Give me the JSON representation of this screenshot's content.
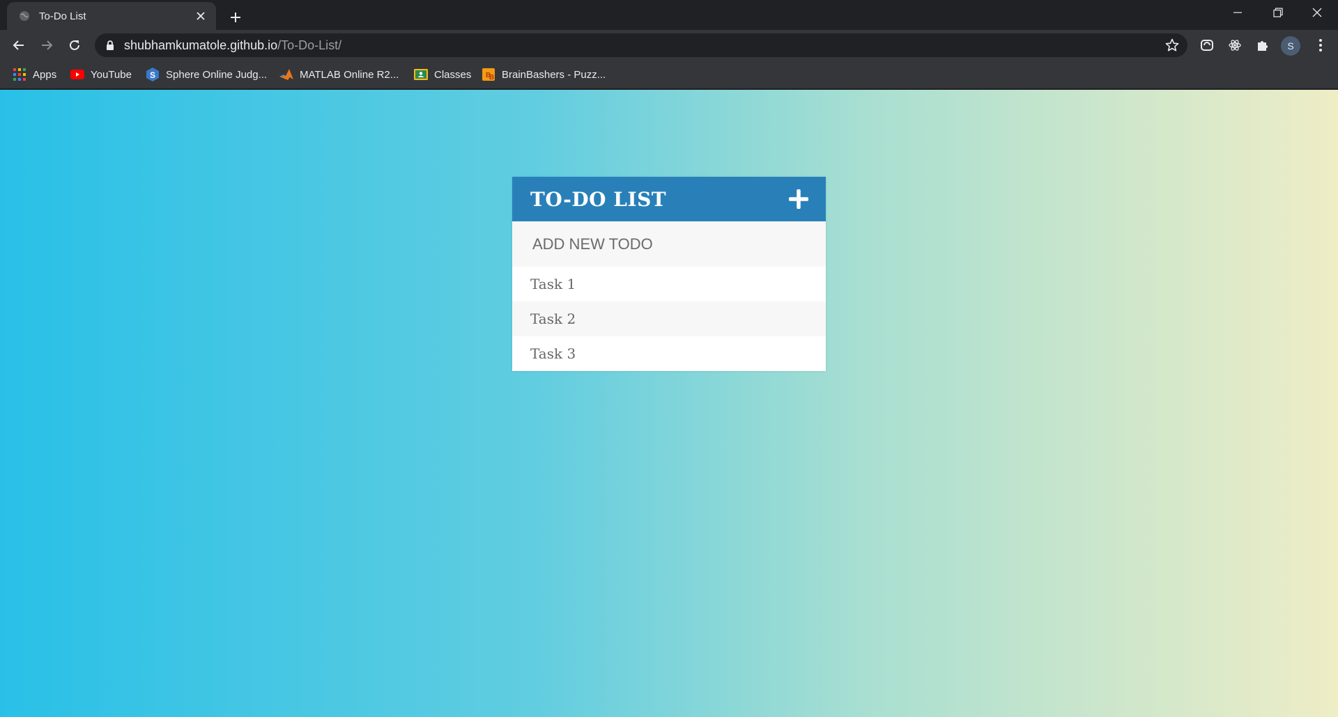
{
  "browser": {
    "tab": {
      "title": "To-Do List"
    },
    "address": {
      "host": "shubhamkumatole.github.io",
      "path": "/To-Do-List/"
    },
    "bookmarks": [
      {
        "label": "Apps",
        "icon": "apps-grid-icon"
      },
      {
        "label": "YouTube",
        "icon": "youtube-icon"
      },
      {
        "label": "Sphere Online Judg...",
        "icon": "spoj-icon"
      },
      {
        "label": "MATLAB Online R2...",
        "icon": "matlab-icon"
      },
      {
        "label": "Classes",
        "icon": "classroom-icon"
      },
      {
        "label": "BrainBashers - Puzz...",
        "icon": "brainbashers-icon"
      }
    ],
    "profile_initial": "S"
  },
  "todo": {
    "title": "TO-DO LIST",
    "input_placeholder": "ADD NEW TODO",
    "items": [
      "Task 1",
      "Task 2",
      "Task 3"
    ]
  },
  "colors": {
    "header": "#2980b9",
    "gradient_start": "#29c0e7",
    "gradient_end": "#eeedc6"
  }
}
